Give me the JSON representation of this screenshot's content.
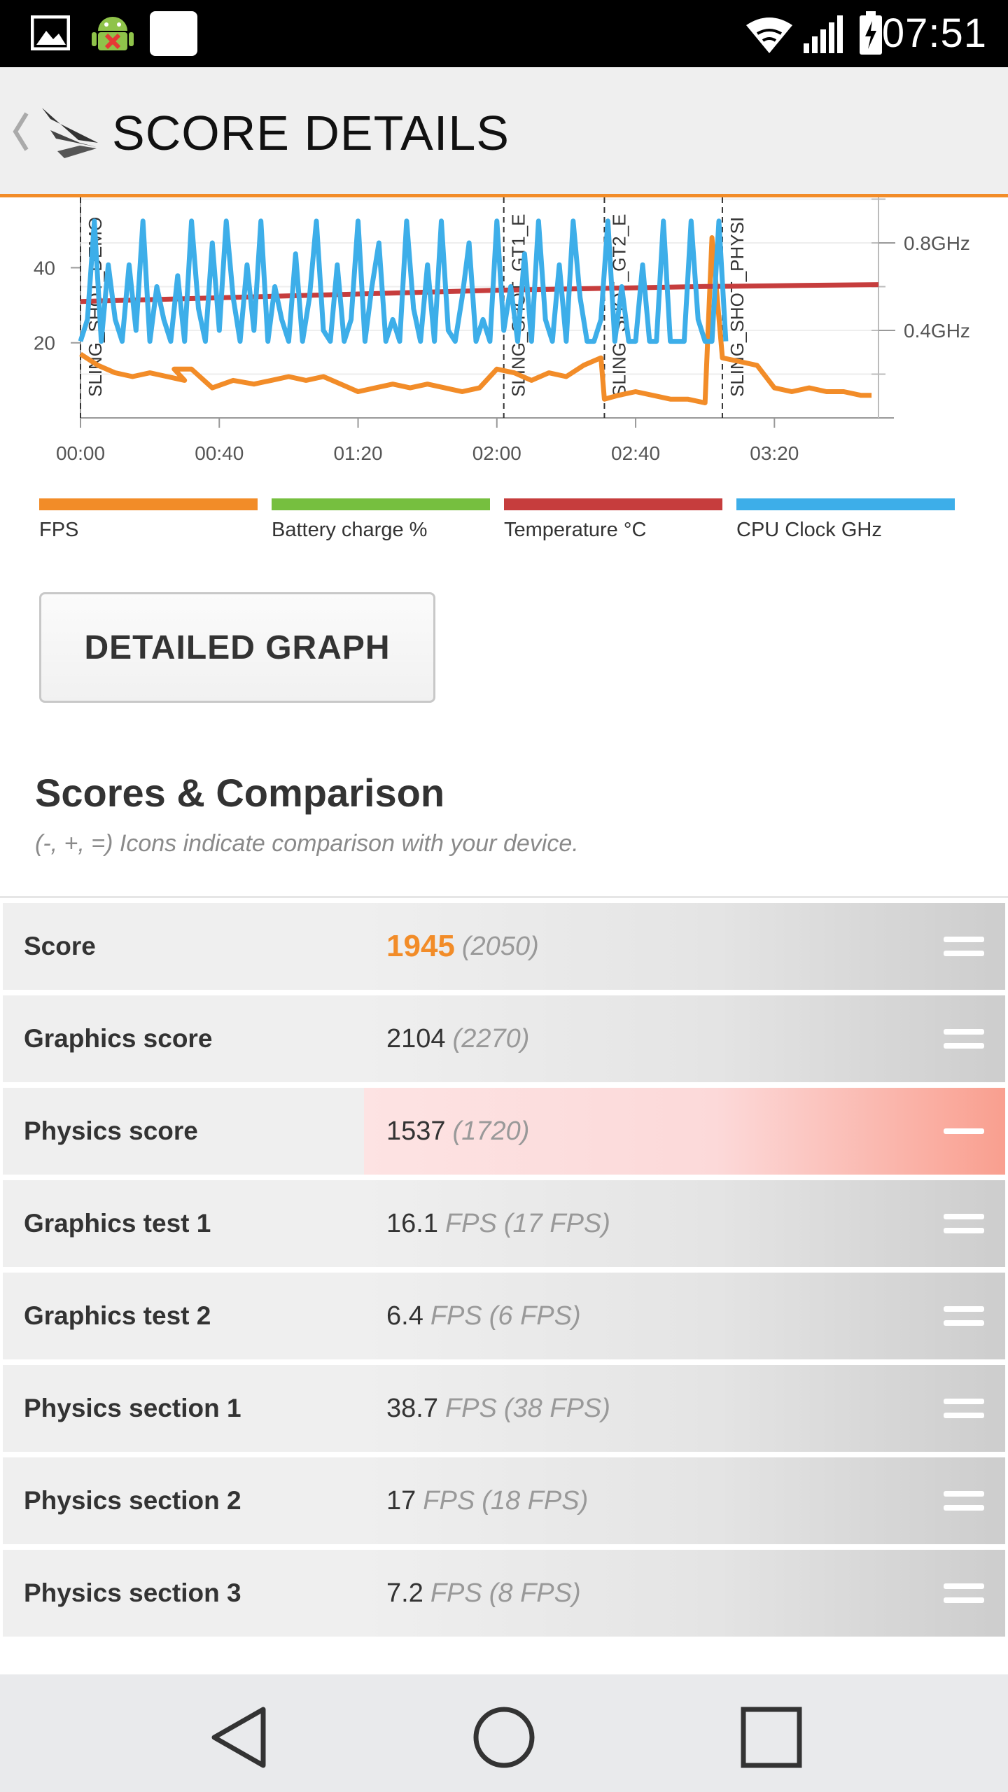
{
  "status_bar": {
    "time": "07:51",
    "icons": [
      "image-notification-icon",
      "android-debug-icon",
      "blank-notification-icon",
      "wifi-icon",
      "signal-icon",
      "battery-charging-icon"
    ]
  },
  "app_bar": {
    "title": "SCORE DETAILS",
    "back_icon": "back-chevron-icon",
    "logo_icon": "app-logo-icon"
  },
  "chart_data": {
    "type": "line",
    "x_tick_labels": [
      "00:00",
      "00:40",
      "01:20",
      "02:00",
      "02:40",
      "03:20"
    ],
    "x_range_seconds": [
      0,
      230
    ],
    "y_left_tick_labels": [
      "20",
      "40"
    ],
    "y_left_range": [
      0,
      55
    ],
    "y_right_tick_labels": [
      "0.4GHz",
      "0.8GHz"
    ],
    "phase_markers": [
      {
        "label": "SLING_SHOT_DEMO",
        "t": 0
      },
      {
        "label": "SLING_SHOT_GT1_E",
        "t": 122
      },
      {
        "label": "SLING_SHOT_GT2_E",
        "t": 151
      },
      {
        "label": "SLING_SHOT_PHYSI",
        "t": 185
      }
    ],
    "series": [
      {
        "name": "FPS",
        "color": "#f28c28",
        "t": [
          0,
          5,
          10,
          15,
          20,
          25,
          30,
          27,
          32,
          38,
          44,
          50,
          55,
          60,
          65,
          70,
          75,
          80,
          85,
          90,
          95,
          100,
          105,
          110,
          115,
          120,
          125,
          130,
          135,
          140,
          145,
          150,
          151,
          155,
          160,
          165,
          170,
          175,
          180,
          182,
          185,
          190,
          195,
          200,
          205,
          210,
          215,
          220,
          225,
          228
        ],
        "v": [
          17,
          14,
          12,
          11,
          12,
          11,
          10,
          13,
          13,
          8,
          10,
          9,
          10,
          11,
          10,
          11,
          9,
          7,
          8,
          9,
          8,
          9,
          8,
          7,
          8,
          13,
          12,
          10,
          12,
          11,
          14,
          16,
          5,
          6,
          7,
          6,
          5,
          5,
          4,
          48,
          16,
          15,
          14,
          8,
          7,
          8,
          7,
          7,
          6,
          6
        ]
      },
      {
        "name": "Temperature °C",
        "color": "#c63d3d",
        "t": [
          0,
          40,
          80,
          120,
          150,
          180,
          200,
          230
        ],
        "v": [
          31,
          32,
          33,
          34,
          34.5,
          35,
          35.2,
          35.5
        ]
      },
      {
        "name": "CPU Clock GHz",
        "color": "#3daee9",
        "t": [
          0,
          2,
          4,
          6,
          8,
          10,
          12,
          14,
          16,
          18,
          20,
          22,
          24,
          26,
          28,
          30,
          32,
          34,
          36,
          38,
          40,
          42,
          44,
          46,
          48,
          50,
          52,
          54,
          56,
          58,
          60,
          62,
          64,
          66,
          68,
          70,
          72,
          74,
          76,
          78,
          80,
          82,
          84,
          86,
          88,
          90,
          92,
          94,
          96,
          98,
          100,
          102,
          104,
          106,
          108,
          110,
          112,
          114,
          116,
          118,
          120,
          122,
          124,
          126,
          128,
          130,
          132,
          134,
          136,
          138,
          140,
          142,
          144,
          146,
          148,
          150,
          152,
          154,
          156,
          158,
          160,
          162,
          164,
          166,
          168,
          170,
          172,
          174,
          176,
          178,
          180,
          182,
          184,
          186
        ],
        "v": [
          0.35,
          0.45,
          0.9,
          0.35,
          0.7,
          0.45,
          0.35,
          0.7,
          0.4,
          0.9,
          0.35,
          0.6,
          0.45,
          0.35,
          0.65,
          0.35,
          0.9,
          0.5,
          0.35,
          0.8,
          0.4,
          0.9,
          0.55,
          0.35,
          0.7,
          0.4,
          0.9,
          0.35,
          0.6,
          0.45,
          0.35,
          0.75,
          0.35,
          0.55,
          0.9,
          0.4,
          0.35,
          0.7,
          0.35,
          0.45,
          0.9,
          0.35,
          0.6,
          0.8,
          0.35,
          0.45,
          0.35,
          0.9,
          0.5,
          0.35,
          0.7,
          0.35,
          0.9,
          0.4,
          0.35,
          0.55,
          0.8,
          0.35,
          0.45,
          0.35,
          0.9,
          0.4,
          0.6,
          0.35,
          0.75,
          0.35,
          0.9,
          0.45,
          0.35,
          0.7,
          0.35,
          0.9,
          0.55,
          0.35,
          0.35,
          0.45,
          0.9,
          0.35,
          0.6,
          0.35,
          0.35,
          0.7,
          0.35,
          0.35,
          0.9,
          0.35,
          0.35,
          0.35,
          0.9,
          0.45,
          0.35,
          0.35,
          0.9,
          0.35
        ]
      }
    ],
    "legend": [
      {
        "name": "FPS",
        "color": "#f28c28"
      },
      {
        "name": "Battery charge %",
        "color": "#76bf3f"
      },
      {
        "name": "Temperature °C",
        "color": "#c63d3d"
      },
      {
        "name": "CPU Clock GHz",
        "color": "#3daee9"
      }
    ]
  },
  "detail_button": {
    "label": "DETAILED GRAPH"
  },
  "scores": {
    "title": "Scores & Comparison",
    "subtitle": "(-, +, =) Icons indicate comparison with your device.",
    "rows": [
      {
        "label": "Score",
        "value": "1945",
        "unit": "",
        "ref": "(2050)",
        "cmp": "equal",
        "main": true
      },
      {
        "label": "Graphics score",
        "value": "2104",
        "unit": "",
        "ref": "(2270)",
        "cmp": "equal"
      },
      {
        "label": "Physics score",
        "value": "1537",
        "unit": "",
        "ref": "(1720)",
        "cmp": "minus"
      },
      {
        "label": "Graphics test 1",
        "value": "16.1",
        "unit": "FPS",
        "ref": "(17 FPS)",
        "cmp": "equal"
      },
      {
        "label": "Graphics test 2",
        "value": "6.4",
        "unit": "FPS",
        "ref": "(6 FPS)",
        "cmp": "equal"
      },
      {
        "label": "Physics section 1",
        "value": "38.7",
        "unit": "FPS",
        "ref": "(38 FPS)",
        "cmp": "equal"
      },
      {
        "label": "Physics section 2",
        "value": "17",
        "unit": "FPS",
        "ref": "(18 FPS)",
        "cmp": "equal"
      },
      {
        "label": "Physics section 3",
        "value": "7.2",
        "unit": "FPS",
        "ref": "(8 FPS)",
        "cmp": "equal"
      }
    ]
  },
  "nav_bar": {
    "buttons": [
      "back-icon",
      "home-icon",
      "recents-icon"
    ]
  }
}
